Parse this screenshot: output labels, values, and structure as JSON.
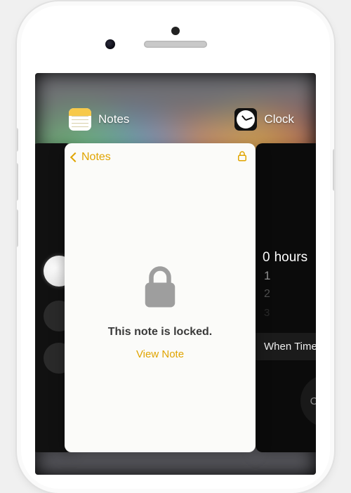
{
  "switcher": {
    "apps": [
      {
        "name": "Notes",
        "icon": "notes-icon"
      },
      {
        "name": "Clock",
        "icon": "clock-icon"
      }
    ]
  },
  "notes_card": {
    "back_label": "Notes",
    "locked_message": "This note is locked.",
    "view_action": "View Note"
  },
  "clock_card": {
    "picker": {
      "selected_value": "0",
      "selected_unit": "hours",
      "below": [
        "1",
        "2",
        "3"
      ]
    },
    "when_timer_ends_label": "When Timer Ends",
    "cancel_label": "Cancel"
  },
  "colors": {
    "notes_accent": "#e0a400"
  }
}
